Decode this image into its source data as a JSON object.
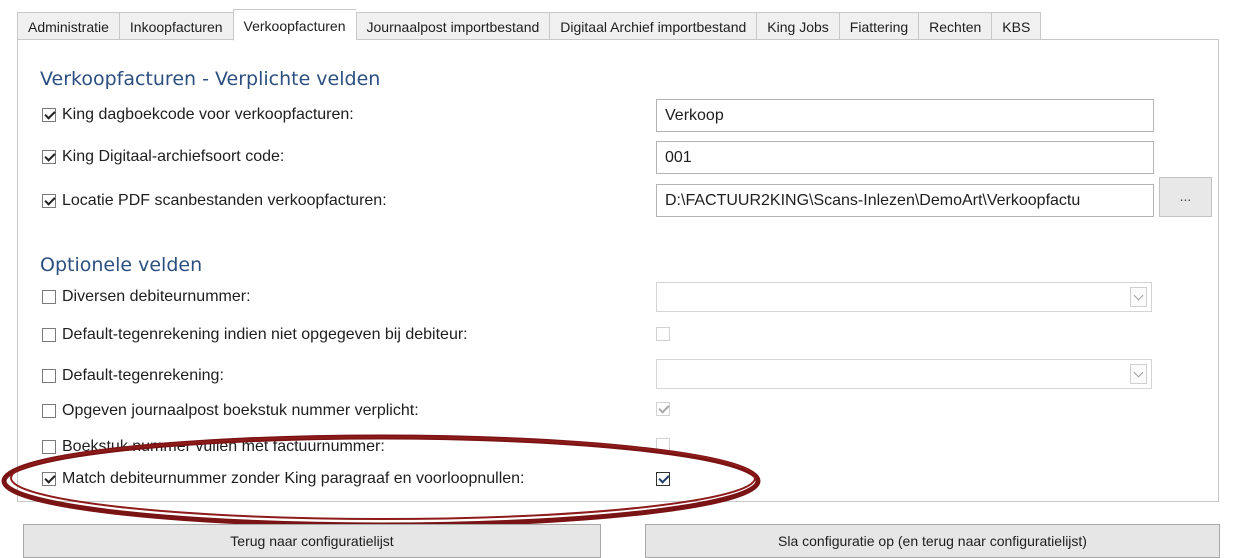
{
  "tabs": [
    {
      "label": "Administratie",
      "active": false
    },
    {
      "label": "Inkoopfacturen",
      "active": false
    },
    {
      "label": "Verkoopfacturen",
      "active": true
    },
    {
      "label": "Journaalpost importbestand",
      "active": false
    },
    {
      "label": "Digitaal Archief importbestand",
      "active": false
    },
    {
      "label": "King Jobs",
      "active": false
    },
    {
      "label": "Fiattering",
      "active": false
    },
    {
      "label": "Rechten",
      "active": false
    },
    {
      "label": "KBS",
      "active": false
    }
  ],
  "required": {
    "title": "Verkoopfacturen - Verplichte velden",
    "fields": [
      {
        "label": "King dagboekcode voor verkoopfacturen:",
        "checked": true,
        "value": "Verkoop"
      },
      {
        "label": "King Digitaal-archiefsoort code:",
        "checked": true,
        "value": "001"
      },
      {
        "label": "Locatie PDF scanbestanden verkoopfacturen:",
        "checked": true,
        "value": "D:\\FACTUUR2KING\\Scans-Inlezen\\DemoArt\\Verkoopfactu"
      }
    ],
    "browse_label": "..."
  },
  "optional": {
    "title": "Optionele velden",
    "fields": [
      {
        "label": "Diversen debiteurnummer:",
        "checked": false,
        "control": "select",
        "value": ""
      },
      {
        "label": "Default-tegenrekening indien niet opgegeven bij debiteur:",
        "checked": false,
        "control": "checkbox",
        "value": false
      },
      {
        "label": "Default-tegenrekening:",
        "checked": false,
        "control": "select",
        "value": ""
      },
      {
        "label": "Opgeven journaalpost boekstuk nummer verplicht:",
        "checked": false,
        "control": "checkbox",
        "value": true
      },
      {
        "label": "Boekstuk nummer vullen met factuurnummer:",
        "checked": false,
        "control": "checkbox",
        "value": false
      },
      {
        "label": "Match debiteurnummer zonder King paragraaf en voorloopnullen:",
        "checked": true,
        "control": "checkbox",
        "value": true
      }
    ]
  },
  "buttons": {
    "back": "Terug naar configuratielijst",
    "save": "Sla configuratie op (en terug naar configuratielijst)"
  },
  "colors": {
    "section_title": "#2b4f80",
    "highlight_ellipse": "#7a1414"
  }
}
